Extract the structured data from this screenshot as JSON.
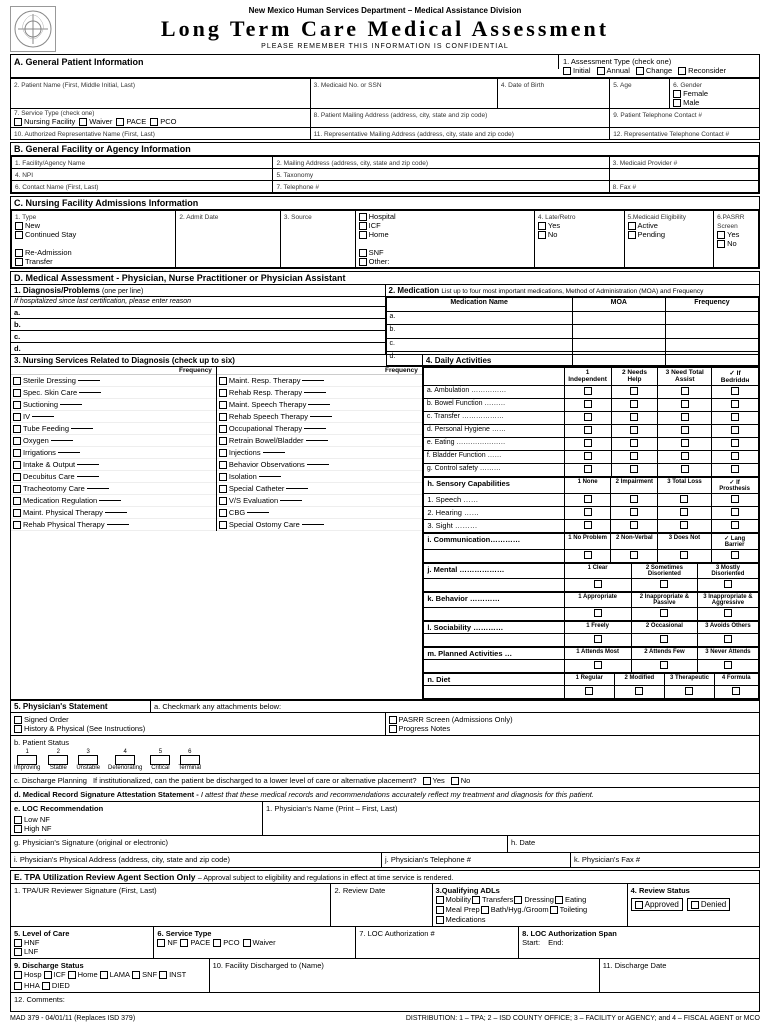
{
  "header": {
    "agency": "New Mexico Human Services Department – Medical Assistance Division",
    "title": "Long Term Care Medical Assessment",
    "subtitle": "PLEASE REMEMBER THIS INFORMATION IS CONFIDENTIAL"
  },
  "sections": {
    "A": {
      "label": "A.",
      "title": "General Patient Information",
      "fields": {
        "assessment_type_label": "1. Assessment Type (check one)",
        "assessment_options": [
          "Initial",
          "Annual",
          "Change",
          "Reconsider"
        ],
        "patient_name_label": "2. Patient Name (First, Middle Initial, Last)",
        "medicaid_label": "3. Medicaid No. or SSN",
        "dob_label": "4. Date of Birth",
        "age_label": "5. Age",
        "gender_label": "6. Gender",
        "gender_options": [
          "Female",
          "Male"
        ],
        "service_type_label": "7. Service Type",
        "service_type_note": "(check one)",
        "service_options": [
          "Nursing Facility",
          "Waiver",
          "PACE",
          "PCO"
        ],
        "mailing_label": "8. Patient Mailing Address (address, city, state and zip code)",
        "phone_label": "9. Patient Telephone Contact #",
        "auth_rep_label": "10. Authorized Representative Name (First, Last)",
        "rep_mailing_label": "11. Representative Mailing Address (address, city, state and zip code)",
        "rep_phone_label": "12. Representative Telephone Contact #"
      }
    },
    "B": {
      "label": "B.",
      "title": "General Facility or Agency Information",
      "fields": {
        "facility_label": "1. Facility/Agency Name",
        "mailing_label": "2. Mailing Address (address, city, state and zip code)",
        "medicaid_provider_label": "3. Medicaid Provider #",
        "npi_label": "4. NPI",
        "taxonomy_label": "5. Taxonomy",
        "contact_label": "6. Contact Name (First, Last)",
        "telephone_label": "7. Telephone #",
        "fax_label": "8. Fax #"
      }
    },
    "C": {
      "label": "C.",
      "title": "Nursing Facility Admissions Information",
      "type_options": [
        "New",
        "Continued Stay",
        "Re-Admission",
        "Transfer"
      ],
      "admit_date_label": "2. Admit Date",
      "source_label": "3. Source",
      "source_options": [
        "Hospital",
        "ICF",
        "Home",
        "SNF",
        "Other:"
      ],
      "late_retro_label": "4. Late/Retro",
      "late_retro_options": [
        "Yes",
        "No"
      ],
      "medicaid_elig_label": "5.Medicaid Eligibility",
      "medicaid_elig_options": [
        "Active",
        "Pending"
      ],
      "pasrr_label": "6.PASRR Screen",
      "pasrr_options": [
        "Yes",
        "No"
      ]
    },
    "D": {
      "label": "D.",
      "title": "Medical Assessment - Physician, Nurse Practitioner or Physician Assistant",
      "diagnosis": {
        "header": "1. Diagnosis/Problems",
        "sub": "(one per line)",
        "instruction": "If hospitalized since last certification, please enter reason",
        "rows": [
          "a.",
          "b.",
          "c.",
          "d."
        ]
      },
      "medication": {
        "header": "2. Medication",
        "sub": "List up to four most important medications, Method of Administration (MOA) and Frequency",
        "columns": [
          "Medication Name",
          "MOA",
          "Frequency"
        ],
        "rows": [
          "a.",
          "b.",
          "c.",
          "d."
        ]
      },
      "nursing_services": {
        "header": "3. Nursing Services Related to Diagnosis (check up to six)",
        "freq_label": "Frequency",
        "left_items": [
          "Sterile Dressing",
          "Spec. Skin Care",
          "Suctioning",
          "IV",
          "Tube Feeding",
          "Oxygen",
          "Irrigations",
          "Intake & Output",
          "Decubitus Care",
          "Tracheotomy Care",
          "Medication Regulation",
          "Maint. Physical Therapy",
          "Rehab Physical Therapy"
        ],
        "right_items": [
          "Maint. Resp. Therapy",
          "Rehab Resp. Therapy",
          "Maint. Speech Therapy",
          "Rehab Speech Therapy",
          "Occupational Therapy",
          "Retrain Bowel/Bladder",
          "Injections",
          "Behavior Observations",
          "Isolation",
          "Special Catheter",
          "V/S Evaluation",
          "CBG",
          "Special Ostomy Care"
        ]
      },
      "daily_activities": {
        "header": "4. Daily Activities",
        "columns": [
          "1 Independent",
          "2 Needs Help",
          "3 Need Total Assist",
          "✓ If Bedriddn"
        ],
        "rows": [
          "a. Ambulation ……………",
          "b. Bowel Function ………",
          "c. Transfer ………………",
          "d. Personal Hygiene ……",
          "e. Eating …………………",
          "f. Bladder Function ……",
          "g. Control safety ………"
        ],
        "sensory_header": "h. Sensory Capabilities",
        "sensory_cols": [
          "1 None",
          "2 Impairment",
          "3 Total Loss",
          "✓ If Prosthesis"
        ],
        "sensory_rows": [
          "1. Speech ……",
          "2. Hearing ……",
          "3. Sight ………"
        ],
        "communication_header": "i. Communication…………",
        "communication_cols": [
          "1 No Problem",
          "2 Non-Verbal",
          "3 Does Not",
          "✓ Lang Barrier"
        ],
        "mental_header": "j. Mental ………………",
        "mental_cols": [
          "1 Clear",
          "2 Sometimes Disoriented",
          "3 Mostly Disoriented"
        ],
        "behavior_header": "k. Behavior …………",
        "behavior_cols": [
          "1 Appropriate",
          "2 Inappropriate & Passive",
          "3 Inappropriate & Aggressive"
        ],
        "sociability_header": "l. Sociability …………",
        "sociability_cols": [
          "1 Freely",
          "2 Occasional",
          "3 Avoids Others"
        ],
        "planned_header": "m. Planned Activities …",
        "planned_cols": [
          "1 Attends Most",
          "2 Attends Few",
          "3 Never Attends"
        ],
        "diet_header": "n. Diet",
        "diet_cols": [
          "1 Regular",
          "2 Modified",
          "3 Therapeutic",
          "4 Formula"
        ]
      },
      "physicians_statement": {
        "header": "5. Physician's Statement",
        "checkmark_note": "a. Checkmark any attachments below:",
        "left_items": [
          "Signed Order",
          "History & Physical (See Instructions)"
        ],
        "right_items": [
          "PASRR Screen (Admissions Only)",
          "Progress Notes"
        ],
        "patient_status_label": "b. Patient Status",
        "status_numbers": [
          "1",
          "2",
          "3",
          "4",
          "5",
          "6"
        ],
        "status_labels": [
          "Improving",
          "Stable",
          "Unstable",
          "Deteriorating",
          "Critical",
          "Terminal"
        ],
        "discharge_label": "c. Discharge Planning",
        "discharge_question": "If institutionalized, can the patient be discharged to a lower level of care or alternative placement?",
        "discharge_options": [
          "Yes",
          "No"
        ],
        "medical_record_label": "d. Medical Record Signature Attestation Statement -",
        "medical_record_text": "I attest that these medical records and recommendations accurately reflect my treatment and diagnosis for this patient.",
        "loc_label": "e. LOC Recommendation",
        "loc_options": [
          "Low NF",
          "High NF"
        ],
        "physician_name_label": "1. Physician's Name (Print – First, Last)",
        "sig_label": "g. Physician's Signature (original or electronic)",
        "date_label": "h. Date",
        "address_label": "i. Physician's Physical Address (address, city, state and zip code)",
        "phone_label": "j. Physician's Telephone #",
        "fax_label": "k. Physician's Fax #"
      }
    },
    "E": {
      "label": "E.",
      "title": "TPA Utilization Review Agent Section Only",
      "subtitle": "– Approval subject to eligibility and regulations in effect at time service is rendered.",
      "fields": {
        "reviewer_sig_label": "1. TPA/UR Reviewer Signature (First, Last)",
        "review_date_label": "2. Review Date",
        "qualifying_adls_label": "3.Qualifying ADLs",
        "qualifying_options": [
          "Mobility",
          "Transfers",
          "Dressing",
          "Eating",
          "Meal Prep",
          "Bath/Hyg./Groom",
          "Toileting",
          "Medications"
        ],
        "review_status_label": "4. Review Status",
        "review_status_options": [
          "Approved",
          "Denied"
        ],
        "level_of_care_label": "5. Level of Care",
        "loc_options": [
          "HNF",
          "LNF"
        ],
        "service_type_label": "6. Service Type",
        "service_options": [
          "NF",
          "PACE",
          "PCO",
          "Waiver"
        ],
        "loc_auth_label": "7. LOC Authorization #",
        "auth_span_label": "8. LOC Authorization Span",
        "start_label": "Start:",
        "end_label": "End:",
        "discharge_label": "9. Discharge Status",
        "discharge_options": [
          "Hosp",
          "ICF",
          "Home",
          "LAMA",
          "SNF",
          "INST",
          "HHA",
          "DIED"
        ],
        "facility_label": "10. Facility Discharged to (Name)",
        "discharge_date_label": "11. Discharge Date",
        "comments_label": "12. Comments:"
      }
    }
  },
  "footer": {
    "form_number": "MAD 379 - 04/01/11 (Replaces ISD 379)",
    "distribution": "DISTRIBUTION: 1 – TPA; 2 – ISD COUNTY OFFICE; 3 – FACILITY or AGENCY; and 4 – FISCAL AGENT or MCO"
  }
}
